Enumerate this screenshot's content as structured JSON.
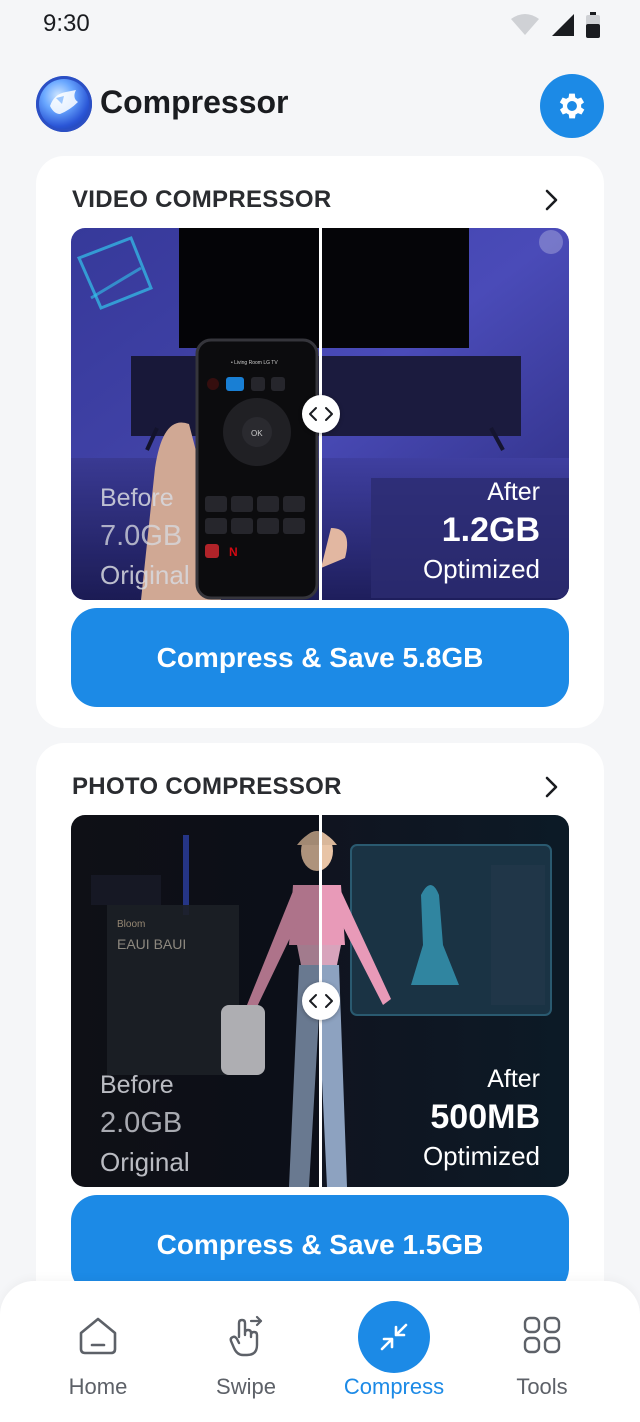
{
  "status_bar": {
    "time": "9:30"
  },
  "header": {
    "title": "Compressor"
  },
  "video_card": {
    "title": "VIDEO COMPRESSOR",
    "before_label": "Before",
    "before_size": "7.0GB",
    "before_sub": "Original",
    "after_label": "After",
    "after_size": "1.2GB",
    "after_sub": "Optimized",
    "button_label": "Compress & Save 5.8GB",
    "phone_caption": "• Living Room LG TV"
  },
  "photo_card": {
    "title": "PHOTO COMPRESSOR",
    "before_label": "Before",
    "before_size": "2.0GB",
    "before_sub": "Original",
    "after_label": "After",
    "after_size": "500MB",
    "after_sub": "Optimized",
    "button_label": "Compress & Save 1.5GB",
    "poster_text": "EAUI BAUI"
  },
  "bottom_nav": {
    "items": [
      {
        "label": "Home",
        "icon": "home-icon"
      },
      {
        "label": "Swipe",
        "icon": "swipe-hand-icon"
      },
      {
        "label": "Compress",
        "icon": "compress-icon",
        "active": true
      },
      {
        "label": "Tools",
        "icon": "tools-grid-icon"
      }
    ]
  },
  "colors": {
    "accent": "#1c8ae6",
    "background": "#f5f6f8",
    "card": "#ffffff"
  }
}
